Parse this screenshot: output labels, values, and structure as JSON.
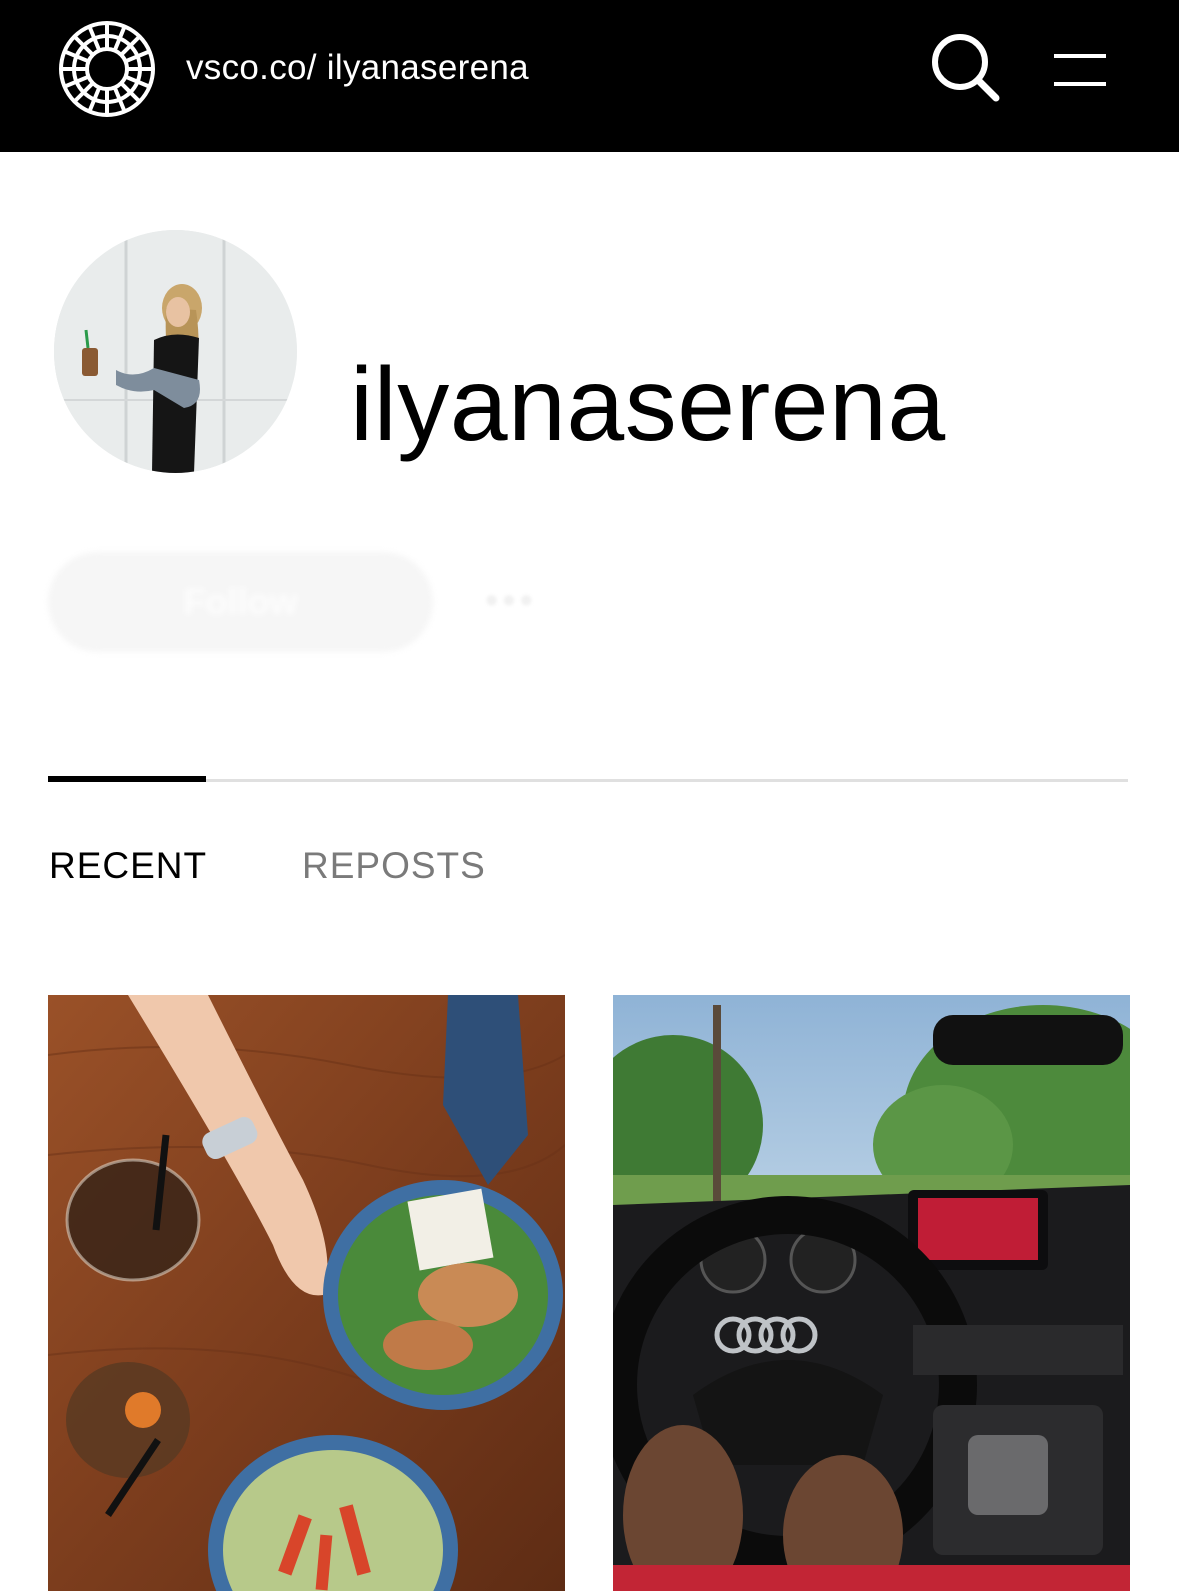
{
  "header": {
    "logo_icon": "vsco-logo-icon",
    "site_url": "vsco.co/ ilyanaserena",
    "search_icon": "search-icon",
    "menu_icon": "hamburger-menu-icon",
    "background": "#000000"
  },
  "profile": {
    "username": "ilyanaserena",
    "avatar": "profile-photo"
  },
  "actions": {
    "follow_label": "Follow",
    "more_label": "•••"
  },
  "tabs": [
    {
      "label": "RECENT",
      "active": true
    },
    {
      "label": "REPOSTS",
      "active": false
    }
  ],
  "photos": [
    {
      "subject": "food-photo"
    },
    {
      "subject": "car-interior-photo"
    }
  ]
}
